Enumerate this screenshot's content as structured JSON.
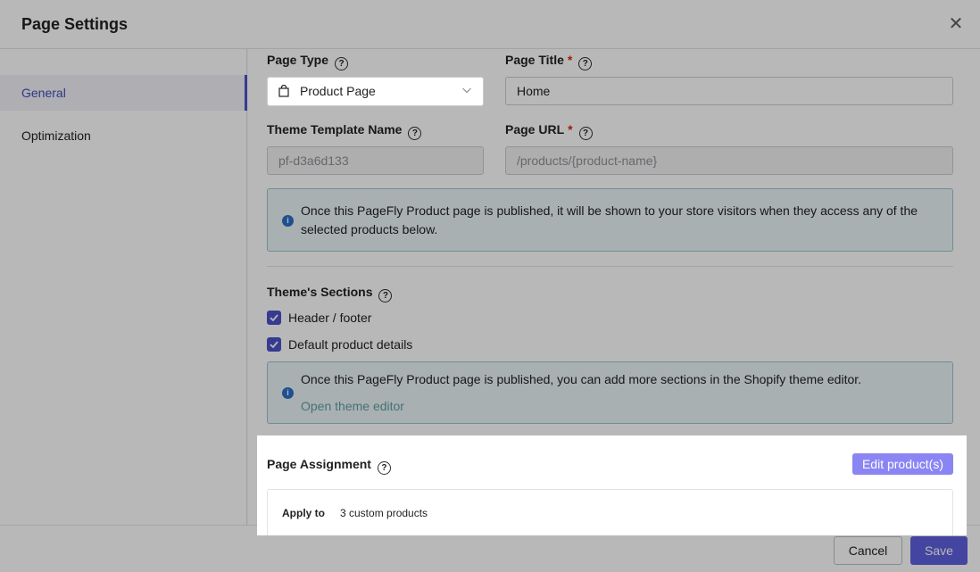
{
  "modal": {
    "title": "Page Settings",
    "close_glyph": "✕"
  },
  "sidebar": {
    "items": [
      {
        "label": "General",
        "active": true
      },
      {
        "label": "Optimization",
        "active": false
      }
    ]
  },
  "page_type": {
    "label": "Page Type",
    "value": "Product Page"
  },
  "page_title": {
    "label": "Page Title",
    "value": "Home"
  },
  "theme_template": {
    "label": "Theme Template Name",
    "value": "pf-d3a6d133"
  },
  "page_url": {
    "label": "Page URL",
    "value": "/products/{product-name}"
  },
  "required_mark": "*",
  "help_glyph": "?",
  "info_glyph": "i",
  "banner1": {
    "text": "Once this PageFly Product page is published, it will be shown to your store visitors when they access any of the selected products below."
  },
  "theme_sections": {
    "label": "Theme's Sections",
    "options": [
      {
        "label": "Header / footer",
        "checked": true
      },
      {
        "label": "Default product details",
        "checked": true
      }
    ]
  },
  "banner2": {
    "text": "Once this PageFly Product page is published, you can add more sections in the Shopify theme editor.",
    "link": "Open theme editor"
  },
  "assignment": {
    "label": "Page Assignment",
    "edit_button": "Edit product(s)",
    "apply_label": "Apply to",
    "apply_value": "3 custom products"
  },
  "footer": {
    "cancel": "Cancel",
    "save": "Save"
  },
  "colors": {
    "accent": "#4b52c9",
    "save": "#5d60de",
    "edit_button": "#8b85f4",
    "banner_bg": "#eaf4f7",
    "required": "#d72c0d"
  },
  "icons": {
    "close": "close-icon",
    "help": "help-icon",
    "bag": "shopping-bag-icon",
    "chevron": "chevron-down-icon",
    "info": "info-icon",
    "check": "checkmark-icon"
  }
}
